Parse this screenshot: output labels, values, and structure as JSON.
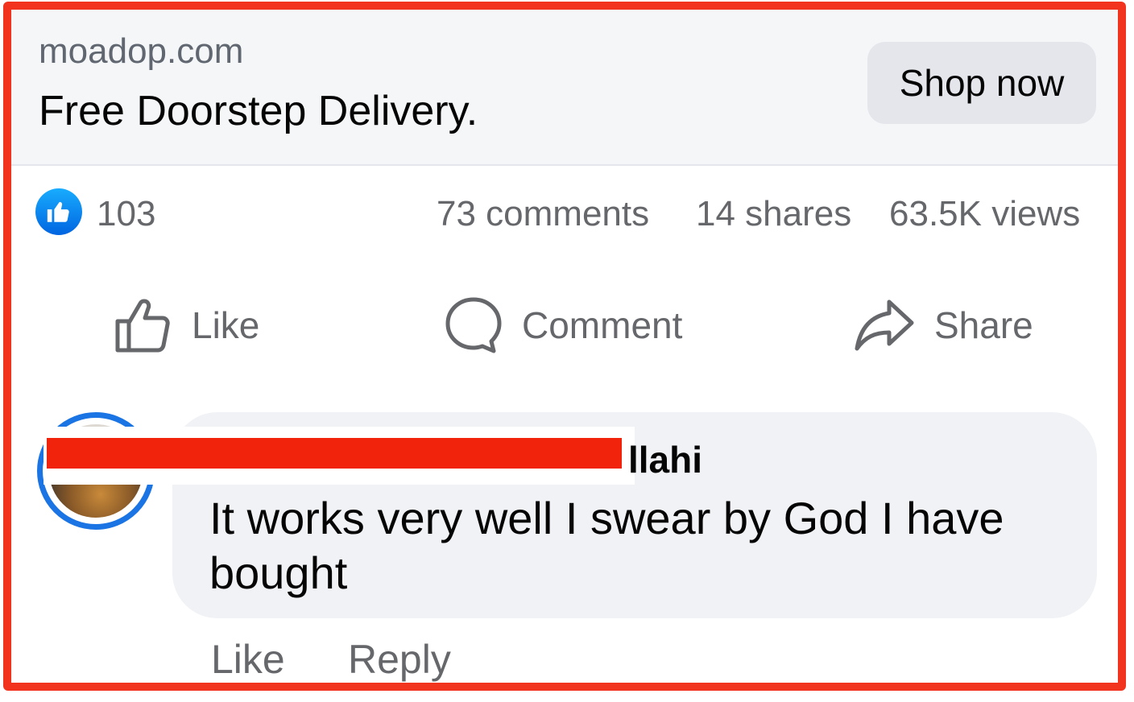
{
  "ad": {
    "domain": "moadop.com",
    "headline": "Free Doorstep Delivery.",
    "cta_label": "Shop now"
  },
  "stats": {
    "like_count": "103",
    "comments": "73 comments",
    "shares": "14 shares",
    "views": "63.5K views"
  },
  "actions": {
    "like": "Like",
    "comment": "Comment",
    "share": "Share"
  },
  "comment": {
    "author_visible": "llahi",
    "text": "It works very well I swear by God I have bought",
    "like_label": "Like",
    "reply_label": "Reply"
  },
  "colors": {
    "frame": "#f2331e",
    "brand_blue": "#1b74e4",
    "muted_text": "#65676b",
    "redaction": "#f2230d"
  },
  "icons": {
    "like_badge": "thumbs-up-icon",
    "like_action": "thumbs-up-outline-icon",
    "comment_action": "speech-bubble-icon",
    "share_action": "share-arrow-icon"
  }
}
